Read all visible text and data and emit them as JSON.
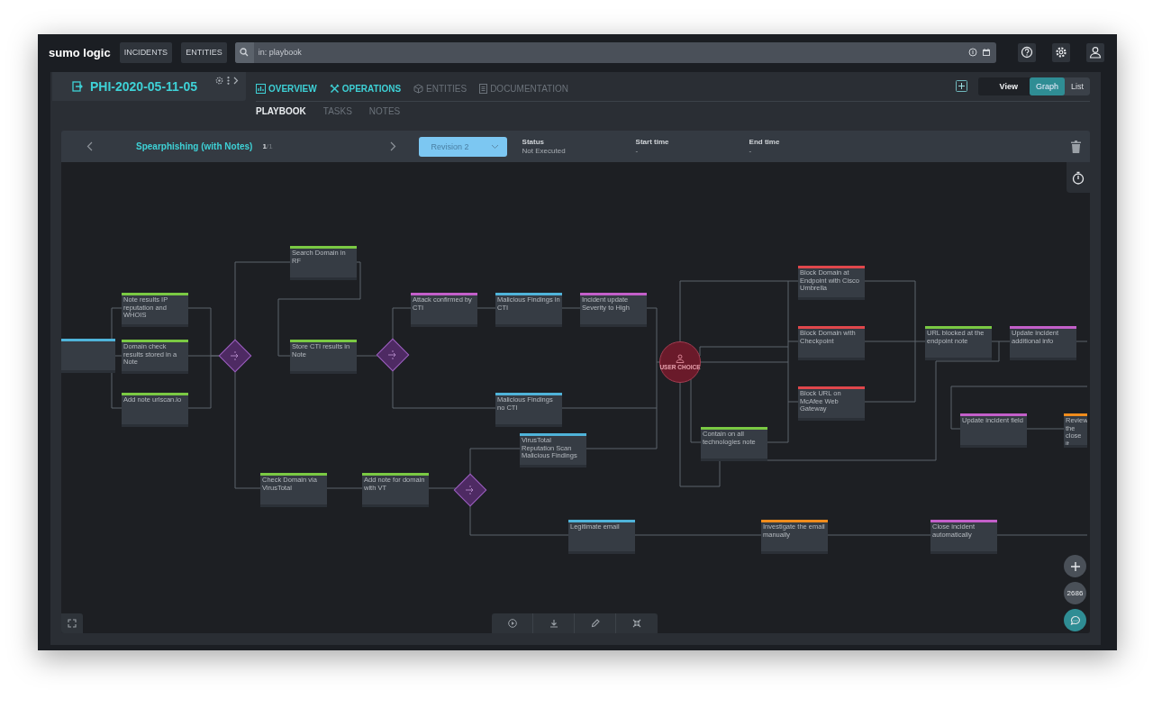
{
  "topbar": {
    "logo": "sumo logic",
    "nav": [
      {
        "label": "INCIDENTS"
      },
      {
        "label": "ENTITIES"
      }
    ],
    "search": {
      "value": "in: playbook"
    }
  },
  "incident": {
    "title": "PHI-2020-05-11-05"
  },
  "tabs": [
    {
      "label": "OVERVIEW",
      "selected": true
    },
    {
      "label": "OPERATIONS",
      "selected": true
    },
    {
      "label": "ENTITIES",
      "selected": false
    },
    {
      "label": "DOCUMENTATION",
      "selected": false
    }
  ],
  "subtabs": [
    {
      "label": "PLAYBOOK",
      "selected": true
    },
    {
      "label": "TASKS",
      "selected": false
    },
    {
      "label": "NOTES",
      "selected": false
    }
  ],
  "view": {
    "label": "View",
    "options": [
      {
        "label": "Graph",
        "selected": true
      },
      {
        "label": "List",
        "selected": false
      }
    ]
  },
  "playbook": {
    "title": "Spearphishing (with Notes)",
    "pager": "**1**/1",
    "revision": "Revision 2",
    "fields": [
      {
        "label": "Status",
        "value": "Not Executed"
      },
      {
        "label": "Start time",
        "value": "-"
      },
      {
        "label": "End time",
        "value": "-"
      }
    ]
  },
  "nodes": [
    {
      "kind": "task",
      "color": "#4fb3d9"
    },
    {
      "kind": "task",
      "color": "#7ac943",
      "label": "Note results IP reputation and WHOIS"
    },
    {
      "kind": "task",
      "color": "#7ac943",
      "label": "Domain check results stored in a Note"
    },
    {
      "kind": "task",
      "color": "#7ac943",
      "label": "Add note urlscan.io"
    },
    {
      "kind": "condition"
    },
    {
      "kind": "task",
      "color": "#7ac943",
      "label": "Search Domain in RF"
    },
    {
      "kind": "task",
      "color": "#7ac943",
      "label": "Store CTI results in Note"
    },
    {
      "kind": "condition"
    },
    {
      "kind": "task",
      "color": "#c35fc9",
      "label": "Attack confirmed by CTI"
    },
    {
      "kind": "task",
      "color": "#4fb3d9",
      "label": "Malicious Findings in CTI"
    },
    {
      "kind": "task",
      "color": "#c35fc9",
      "label": "Incident update Severity to High"
    },
    {
      "kind": "task",
      "color": "#4fb3d9",
      "label": "Malicious Findings no CTI"
    },
    {
      "kind": "user_choice",
      "label": "USER CHOICE"
    },
    {
      "kind": "task",
      "color": "#e0474c",
      "label": "Block Domain at Endpoint with Cisco Umbrella"
    },
    {
      "kind": "task",
      "color": "#e0474c",
      "label": "Block Domain with Checkpoint"
    },
    {
      "kind": "task",
      "color": "#e0474c",
      "label": "Block URL on McAfee Web Gateway"
    },
    {
      "kind": "task",
      "color": "#7ac943",
      "label": "Contain on all technologies note"
    },
    {
      "kind": "task",
      "color": "#7ac943",
      "label": "URL blocked at the endpoint note"
    },
    {
      "kind": "task",
      "color": "#c35fc9",
      "label": "Update incident additional info"
    },
    {
      "kind": "task",
      "color": "#c35fc9",
      "label": "Update incident field"
    },
    {
      "kind": "task",
      "color": "#f08c1c",
      "label": "Review the close it"
    },
    {
      "kind": "task",
      "color": "#7ac943",
      "label": "Check Domain via VirusTotal"
    },
    {
      "kind": "task",
      "color": "#7ac943",
      "label": "Add note for domain with VT"
    },
    {
      "kind": "condition"
    },
    {
      "kind": "task",
      "color": "#4fb3d9",
      "label": "VirusTotal Reputation Scan Malicious Findings"
    },
    {
      "kind": "task",
      "color": "#4fb3d9",
      "label": "Legitimate email"
    },
    {
      "kind": "task",
      "color": "#f08c1c",
      "label": "Investigate the email manually"
    },
    {
      "kind": "task",
      "color": "#c35fc9",
      "label": "Close incident automatically"
    }
  ],
  "zoom": "2686"
}
